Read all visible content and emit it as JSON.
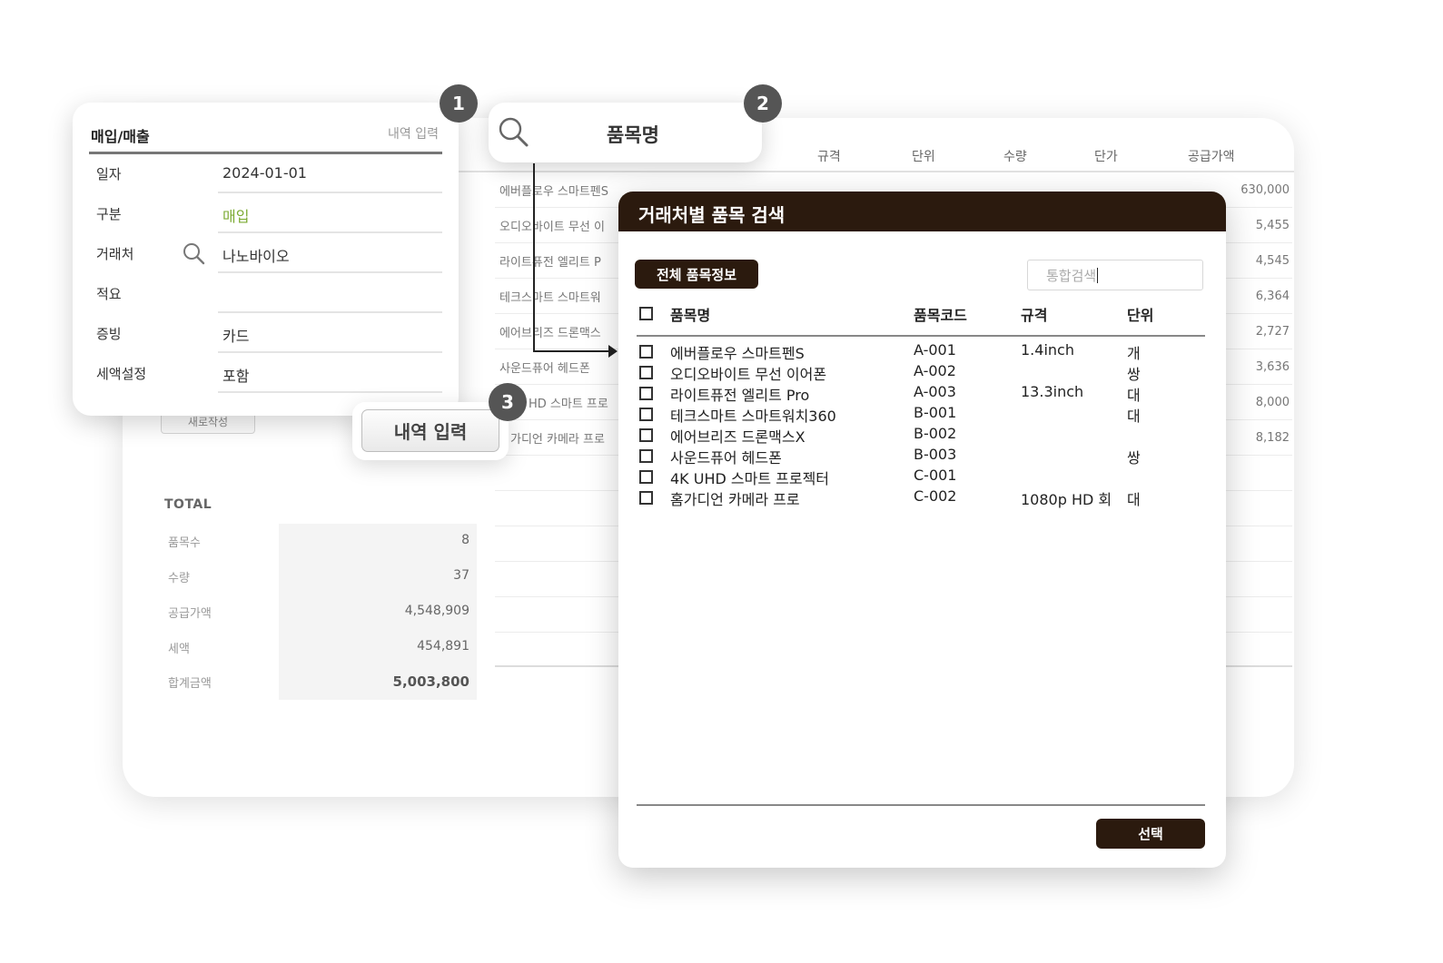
{
  "background_table": {
    "headers": {
      "spec": "규격",
      "unit": "단위",
      "qty": "수량",
      "price": "단가",
      "supply": "공급가액"
    },
    "rows": [
      {
        "name": "에버플로우 스마트펜S",
        "amount": "630,000"
      },
      {
        "name": "오디오바이트 무선 이",
        "amount": "5,455"
      },
      {
        "name": "라이트퓨전 엘리트 P",
        "amount": "4,545"
      },
      {
        "name": "테크스마트 스마트워",
        "amount": "6,364"
      },
      {
        "name": "에어브리즈 드론맥스",
        "amount": "2,727"
      },
      {
        "name": "사운드퓨어 헤드폰",
        "amount": "3,636"
      },
      {
        "name": "HD 스마트 프로",
        "amount": "8,000"
      },
      {
        "name": "가디언 카메라 프로",
        "amount": "8,182"
      }
    ],
    "reset_label": "새로작성"
  },
  "totals": {
    "title": "TOTAL",
    "rows": [
      {
        "label": "품목수",
        "value": "8"
      },
      {
        "label": "수량",
        "value": "37"
      },
      {
        "label": "공급가액",
        "value": "4,548,909"
      },
      {
        "label": "세액",
        "value": "454,891"
      },
      {
        "label": "합계금액",
        "value": "5,003,800"
      }
    ]
  },
  "form": {
    "title": "매입/매출",
    "subtitle": "내역 입력",
    "fields": [
      {
        "label": "일자",
        "value": "2024-01-01"
      },
      {
        "label": "구분",
        "value": "매입"
      },
      {
        "label": "거래처",
        "value": "나노바이오"
      },
      {
        "label": "적요",
        "value": ""
      },
      {
        "label": "증빙",
        "value": "카드"
      },
      {
        "label": "세액설정",
        "value": "포함"
      }
    ]
  },
  "search_field": {
    "label": "품목명"
  },
  "input_button": {
    "label": "내역 입력"
  },
  "badges": [
    "1",
    "2",
    "3"
  ],
  "modal": {
    "title": "거래처별 품목 검색",
    "all_button": "전체 품목정보",
    "search_placeholder": "통합검색",
    "columns": [
      "품목명",
      "품목코드",
      "규격",
      "단위"
    ],
    "items": [
      {
        "name": "에버플로우 스마트펜S",
        "code": "A-001",
        "spec": "1.4inch",
        "unit": "개"
      },
      {
        "name": "오디오바이트 무선 이어폰",
        "code": "A-002",
        "spec": "",
        "unit": "쌍"
      },
      {
        "name": "라이트퓨전 엘리트 Pro",
        "code": "A-003",
        "spec": "13.3inch",
        "unit": "대"
      },
      {
        "name": "테크스마트 스마트워치360",
        "code": "B-001",
        "spec": "",
        "unit": "대"
      },
      {
        "name": "에어브리즈 드론맥스X",
        "code": "B-002",
        "spec": "",
        "unit": ""
      },
      {
        "name": "사운드퓨어 헤드폰",
        "code": "B-003",
        "spec": "",
        "unit": "쌍"
      },
      {
        "name": "4K UHD 스마트 프로젝터",
        "code": "C-001",
        "spec": "",
        "unit": ""
      },
      {
        "name": "홈가디언 카메라 프로",
        "code": "C-002",
        "spec": "1080p HD 회",
        "unit": "대"
      }
    ],
    "select_button": "선택"
  },
  "colors": {
    "accent_dark": "#2b1a0e",
    "green": "#7dab35",
    "badge": "#555555"
  }
}
